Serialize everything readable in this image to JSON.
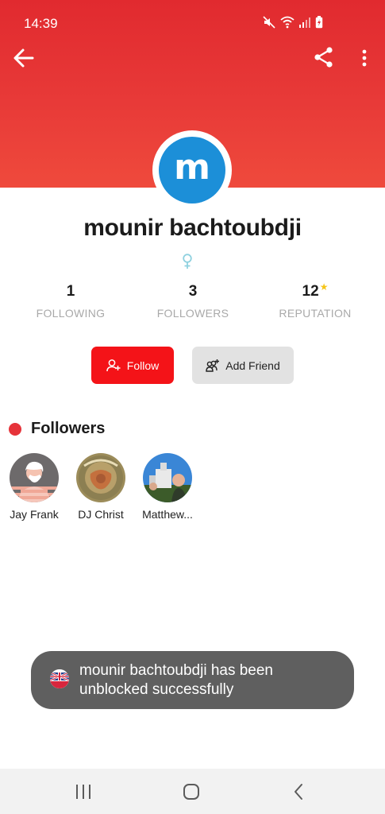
{
  "status_bar": {
    "time": "14:39",
    "icons": [
      "mute-icon",
      "wifi-icon",
      "signal-icon",
      "battery-charging-icon"
    ]
  },
  "toolbar": {
    "back_icon": "arrow-left-icon",
    "share_icon": "share-icon",
    "more_icon": "more-vertical-icon"
  },
  "profile": {
    "avatar_letter": "m",
    "name": "mounir bachtoubdji",
    "gender_icon": "female-symbol-icon"
  },
  "stats": [
    {
      "value": "1",
      "label": "FOLLOWING"
    },
    {
      "value": "3",
      "label": "FOLLOWERS"
    },
    {
      "value": "12",
      "label": "REPUTATION",
      "badge_icon": "star-icon"
    }
  ],
  "actions": {
    "follow_label": "Follow",
    "add_friend_label": "Add Friend"
  },
  "followers_section": {
    "title": "Followers",
    "items": [
      {
        "name": "Jay Frank"
      },
      {
        "name": "DJ Christ"
      },
      {
        "name": "Matthew..."
      }
    ]
  },
  "toast": {
    "message": "mounir bachtoubdji has been unblocked successfully"
  },
  "nav": {
    "recents_icon": "recent-apps-icon",
    "home_icon": "home-icon",
    "back_icon": "back-chevron-icon"
  },
  "colors": {
    "header_red": "#e12a2f",
    "follow_red": "#f41318",
    "avatar_blue": "#1c8fd8",
    "star_yellow": "#f5c518",
    "toast_gray": "#5f5f5f"
  }
}
